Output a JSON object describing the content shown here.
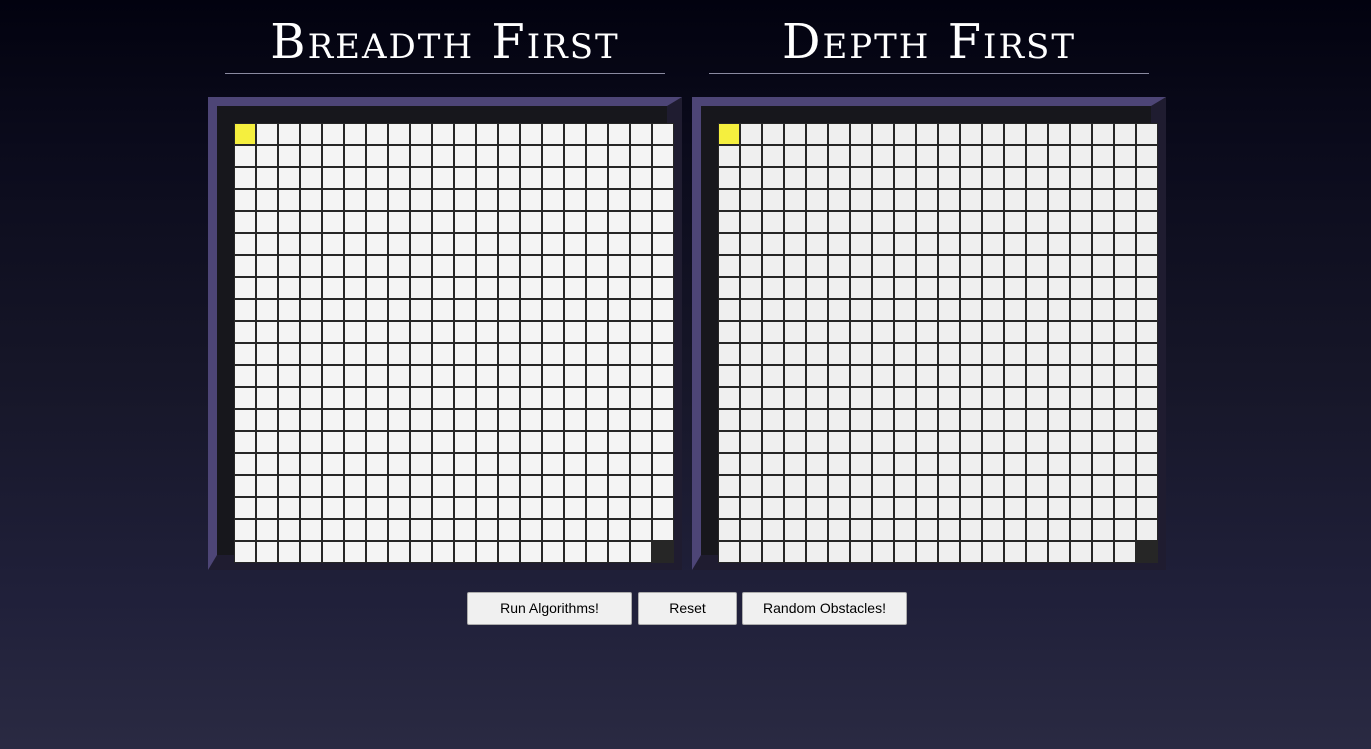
{
  "panels": {
    "bfs": {
      "title": "Breadth First"
    },
    "dfs": {
      "title": "Depth First"
    }
  },
  "grid": {
    "rows": 20,
    "cols": 20,
    "start": {
      "row": 0,
      "col": 0,
      "color": "#f5ef3e"
    },
    "goal": {
      "row": 19,
      "col": 19,
      "color": "#262626"
    },
    "empty_color": "#f4f4f4"
  },
  "buttons": {
    "run": "Run Algorithms!",
    "reset": "Reset",
    "random": "Random Obstacles!"
  }
}
